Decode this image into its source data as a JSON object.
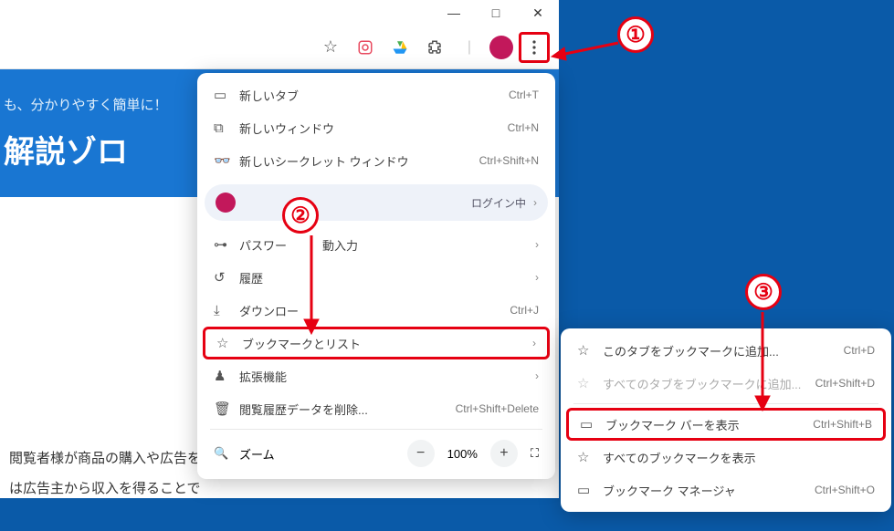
{
  "window": {
    "minimize": "—",
    "maximize": "□",
    "close": "✕"
  },
  "toolbar": {
    "star": "☆"
  },
  "banner": {
    "sub": "も、分かりやすく簡単に！",
    "title": "解説ゾロ"
  },
  "content": {
    "line1": "閲覧者様が商品の購入や広告を",
    "line2": "は広告主から収入を得ることで"
  },
  "menu": {
    "new_tab": {
      "label": "新しいタブ",
      "shortcut": "Ctrl+T"
    },
    "new_window": {
      "label": "新しいウィンドウ",
      "shortcut": "Ctrl+N"
    },
    "incognito": {
      "label": "新しいシークレット ウィンドウ",
      "shortcut": "Ctrl+Shift+N"
    },
    "profile_status": "ログイン中",
    "passwords": {
      "label": "パスワー",
      "label2": "動入力"
    },
    "history": {
      "label": "履歴"
    },
    "downloads": {
      "label": "ダウンロー",
      "shortcut": "Ctrl+J"
    },
    "bookmarks": {
      "label": "ブックマークとリスト"
    },
    "extensions": {
      "label": "拡張機能"
    },
    "clear_data": {
      "label": "閲覧履歴データを削除...",
      "shortcut": "Ctrl+Shift+Delete"
    },
    "zoom": {
      "label": "ズーム",
      "value": "100%"
    }
  },
  "submenu": {
    "bookmark_tab": {
      "label": "このタブをブックマークに追加...",
      "shortcut": "Ctrl+D"
    },
    "bookmark_all": {
      "label": "すべてのタブをブックマークに追加...",
      "shortcut": "Ctrl+Shift+D"
    },
    "show_bar": {
      "label": "ブックマーク バーを表示",
      "shortcut": "Ctrl+Shift+B"
    },
    "show_all": {
      "label": "すべてのブックマークを表示"
    },
    "manager": {
      "label": "ブックマーク マネージャ",
      "shortcut": "Ctrl+Shift+O"
    }
  },
  "callouts": {
    "c1": "①",
    "c2": "②",
    "c3": "③"
  }
}
